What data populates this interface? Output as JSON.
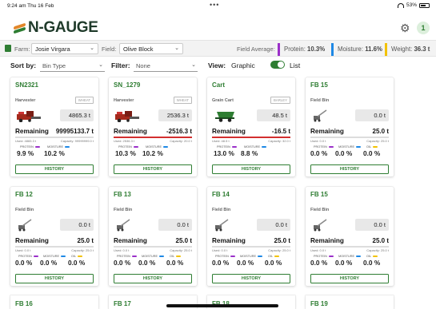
{
  "status_bar": {
    "time": "9:24 am  Thu 16 Feb",
    "battery": "53%"
  },
  "header": {
    "app_name": "N-GAUGE",
    "user_initial": "1"
  },
  "filters": {
    "farm_label": "Farm:",
    "farm_value": "Josie Virgara",
    "field_label": "Field:",
    "field_value": "Olive Block",
    "field_average_label": "Field Average:",
    "protein_label": "Protein:",
    "protein_value": "10.3%",
    "moisture_label": "Moisture:",
    "moisture_value": "11.6%",
    "weight_label": "Weight:",
    "weight_value": "36.3 t"
  },
  "controls": {
    "sort_label": "Sort by:",
    "sort_value": "Bin Type",
    "filter_label": "Filter:",
    "filter_value": "None",
    "view_label": "View:",
    "view_graphic": "Graphic",
    "view_list": "List"
  },
  "colors": {
    "brand_green": "#2e7d32",
    "protein": "#9b30c9",
    "moisture": "#1e88e5",
    "oil": "#f2c200",
    "overfill": "#d32f2f"
  },
  "cards": [
    {
      "name": "SN2321",
      "type": "Harvester",
      "crop": "WHEAT",
      "weight": "4865.3 t",
      "remaining_label": "Remaining",
      "remaining": "99995133.7 t",
      "used": "Used: 4865.3 t",
      "capacity": "Capacity: 99999999.0 t",
      "fill": 0.0,
      "fill_color": "#2e7d32",
      "icon": "harvester-icon",
      "labels": [
        "PROTEIN",
        "MOISTURE"
      ],
      "values": [
        "9.9 %",
        "10.2 %"
      ],
      "history": "HISTORY"
    },
    {
      "name": "SN_1279",
      "type": "Harvester",
      "crop": "WHEAT",
      "weight": "2536.3 t",
      "remaining_label": "Remaining",
      "remaining": "-2516.3 t",
      "used": "Used: 2536.3 t",
      "capacity": "Capacity: 20.0 t",
      "fill": 1.0,
      "fill_color": "#d32f2f",
      "icon": "harvester-icon",
      "labels": [
        "PROTEIN",
        "MOISTURE"
      ],
      "values": [
        "10.3 %",
        "10.2 %"
      ],
      "history": "HISTORY"
    },
    {
      "name": "Cart",
      "type": "Grain Cart",
      "crop": "BARLEY",
      "weight": "48.5 t",
      "remaining_label": "Remaining",
      "remaining": "-16.5 t",
      "used": "Used: 48.5 t",
      "capacity": "Capacity: 32.0 t",
      "fill": 1.0,
      "fill_color": "#d32f2f",
      "icon": "grain-cart-icon",
      "labels": [
        "PROTEIN",
        "MOISTURE"
      ],
      "values": [
        "13.0 %",
        "8.8 %"
      ],
      "history": "HISTORY"
    },
    {
      "name": "FB 15",
      "type": "Field Bin",
      "crop": "",
      "weight": "0.0 t",
      "remaining_label": "Remaining",
      "remaining": "25.0 t",
      "used": "Used: 0.0 t",
      "capacity": "Capacity: 25.0 t",
      "fill": 0.0,
      "fill_color": "#2e7d32",
      "icon": "field-bin-icon",
      "labels": [
        "PROTEIN",
        "MOISTURE",
        "OIL"
      ],
      "values": [
        "0.0 %",
        "0.0 %",
        "0.0 %"
      ],
      "history": "HISTORY"
    },
    {
      "name": "FB 12",
      "type": "Field Bin",
      "crop": "",
      "weight": "0.0 t",
      "remaining_label": "Remaining",
      "remaining": "25.0 t",
      "used": "Used: 0.0 t",
      "capacity": "Capacity: 25.0 t",
      "fill": 0.0,
      "fill_color": "#2e7d32",
      "icon": "field-bin-icon",
      "labels": [
        "PROTEIN",
        "MOISTURE",
        "OIL"
      ],
      "values": [
        "0.0 %",
        "0.0 %",
        "0.0 %"
      ],
      "history": "HISTORY"
    },
    {
      "name": "FB 13",
      "type": "Field Bin",
      "crop": "",
      "weight": "0.0 t",
      "remaining_label": "Remaining",
      "remaining": "25.0 t",
      "used": "Used: 0.0 t",
      "capacity": "Capacity: 25.0 t",
      "fill": 0.0,
      "fill_color": "#2e7d32",
      "icon": "field-bin-icon",
      "labels": [
        "PROTEIN",
        "MOISTURE",
        "OIL"
      ],
      "values": [
        "0.0 %",
        "0.0 %",
        "0.0 %"
      ],
      "history": "HISTORY"
    },
    {
      "name": "FB 14",
      "type": "Field Bin",
      "crop": "",
      "weight": "0.0 t",
      "remaining_label": "Remaining",
      "remaining": "25.0 t",
      "used": "Used: 0.0 t",
      "capacity": "Capacity: 25.0 t",
      "fill": 0.0,
      "fill_color": "#2e7d32",
      "icon": "field-bin-icon",
      "labels": [
        "PROTEIN",
        "MOISTURE",
        "OIL"
      ],
      "values": [
        "0.0 %",
        "0.0 %",
        "0.0 %"
      ],
      "history": "HISTORY"
    },
    {
      "name": "FB 15",
      "type": "Field Bin",
      "crop": "",
      "weight": "0.0 t",
      "remaining_label": "Remaining",
      "remaining": "25.0 t",
      "used": "Used: 0.0 t",
      "capacity": "Capacity: 25.0 t",
      "fill": 0.0,
      "fill_color": "#2e7d32",
      "icon": "field-bin-icon",
      "labels": [
        "PROTEIN",
        "MOISTURE",
        "OIL"
      ],
      "values": [
        "0.0 %",
        "0.0 %",
        "0.0 %"
      ],
      "history": "HISTORY"
    }
  ],
  "partial_cards": [
    "FB 16",
    "FB 17",
    "FB 18",
    "FB 19"
  ]
}
